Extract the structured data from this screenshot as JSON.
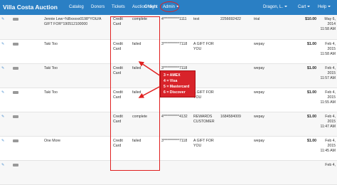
{
  "navbar": {
    "brand": "Villa Costa Auction",
    "items": [
      "Catalog",
      "Donors",
      "Tickets",
      "Auction Night",
      "Orders",
      "Admin"
    ],
    "user": "Dragon, L.",
    "cart": "Cart",
    "help": "Help",
    "colors": {
      "bar": "#2a7fc4",
      "highlight": "#e02020"
    }
  },
  "orders": {
    "rows": [
      {
        "name": "Jennie Lew~%Bxxxxx0198^YOU/A GIFT FOR^190512100000",
        "method": "Credit Card",
        "status": "complete",
        "card": "4***********1111",
        "note": "test",
        "ref": "2256692422",
        "gateway": "trial",
        "amount": "$10.00",
        "date": "May 6, 2014 11:58 AM"
      },
      {
        "name": "Taki Too",
        "method": "Credit Card",
        "status": "failed",
        "card": "3***********7118",
        "note": "A GIFT FOR YOU",
        "ref": "",
        "gateway": "wepay",
        "amount": "$1.00",
        "date": "Feb 4, 2015 11:58 AM"
      },
      {
        "name": "Taki Too",
        "method": "Credit Card",
        "status": "failed",
        "card": "3***********7118",
        "note": "",
        "ref": "",
        "gateway": "wepay",
        "amount": "$1.00",
        "date": "Feb 4, 2015 11:57 AM"
      },
      {
        "name": "Taki Too",
        "method": "Credit Card",
        "status": "failed",
        "card": "4***********4132",
        "note": "A GIFT FOR YOU",
        "ref": "",
        "gateway": "wepay",
        "amount": "$1.00",
        "date": "Feb 4, 2015 11:55 AM"
      },
      {
        "name": "",
        "method": "Credit Card",
        "status": "complete",
        "card": "4***********4132",
        "note": "REWARDS CUSTOMER",
        "ref": "1684584009",
        "gateway": "wepay",
        "amount": "$1.00",
        "date": "Feb 4, 2015 11:47 AM"
      },
      {
        "name": "One More",
        "method": "Credit Card",
        "status": "failed",
        "card": "3***********7118",
        "note": "A GIFT FOR YOU",
        "ref": "",
        "gateway": "wepay",
        "amount": "$1.00",
        "date": "Feb 4, 2015 11:45 AM"
      },
      {
        "name": "",
        "method": "",
        "status": "",
        "card": "",
        "note": "",
        "ref": "",
        "gateway": "",
        "amount": "",
        "date": "Feb 4,"
      }
    ]
  },
  "legend": {
    "lines": [
      "3 = AMEX",
      "4 = Visa",
      "5 = Mastercard",
      "6 = Discover"
    ]
  }
}
